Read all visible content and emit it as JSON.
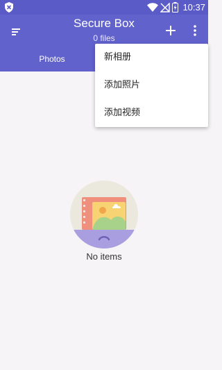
{
  "status_bar": {
    "time": "10:37",
    "icons": [
      "shield-icon",
      "wifi-icon",
      "no-signal-icon",
      "battery-charging-icon"
    ],
    "color": "#5b5bc8"
  },
  "app_bar": {
    "title": "Secure Box",
    "subtitle": "0 files",
    "color": "#6262cd",
    "icons": [
      "sort-menu-icon",
      "add-icon",
      "more-vert-icon"
    ]
  },
  "tabs": [
    {
      "label": "Photos"
    }
  ],
  "menu": {
    "items": [
      {
        "label": "新相册"
      },
      {
        "label": "添加照片"
      },
      {
        "label": "添加视频"
      }
    ]
  },
  "empty_state": {
    "text": "No items",
    "icon": "empty-gallery-icon"
  }
}
